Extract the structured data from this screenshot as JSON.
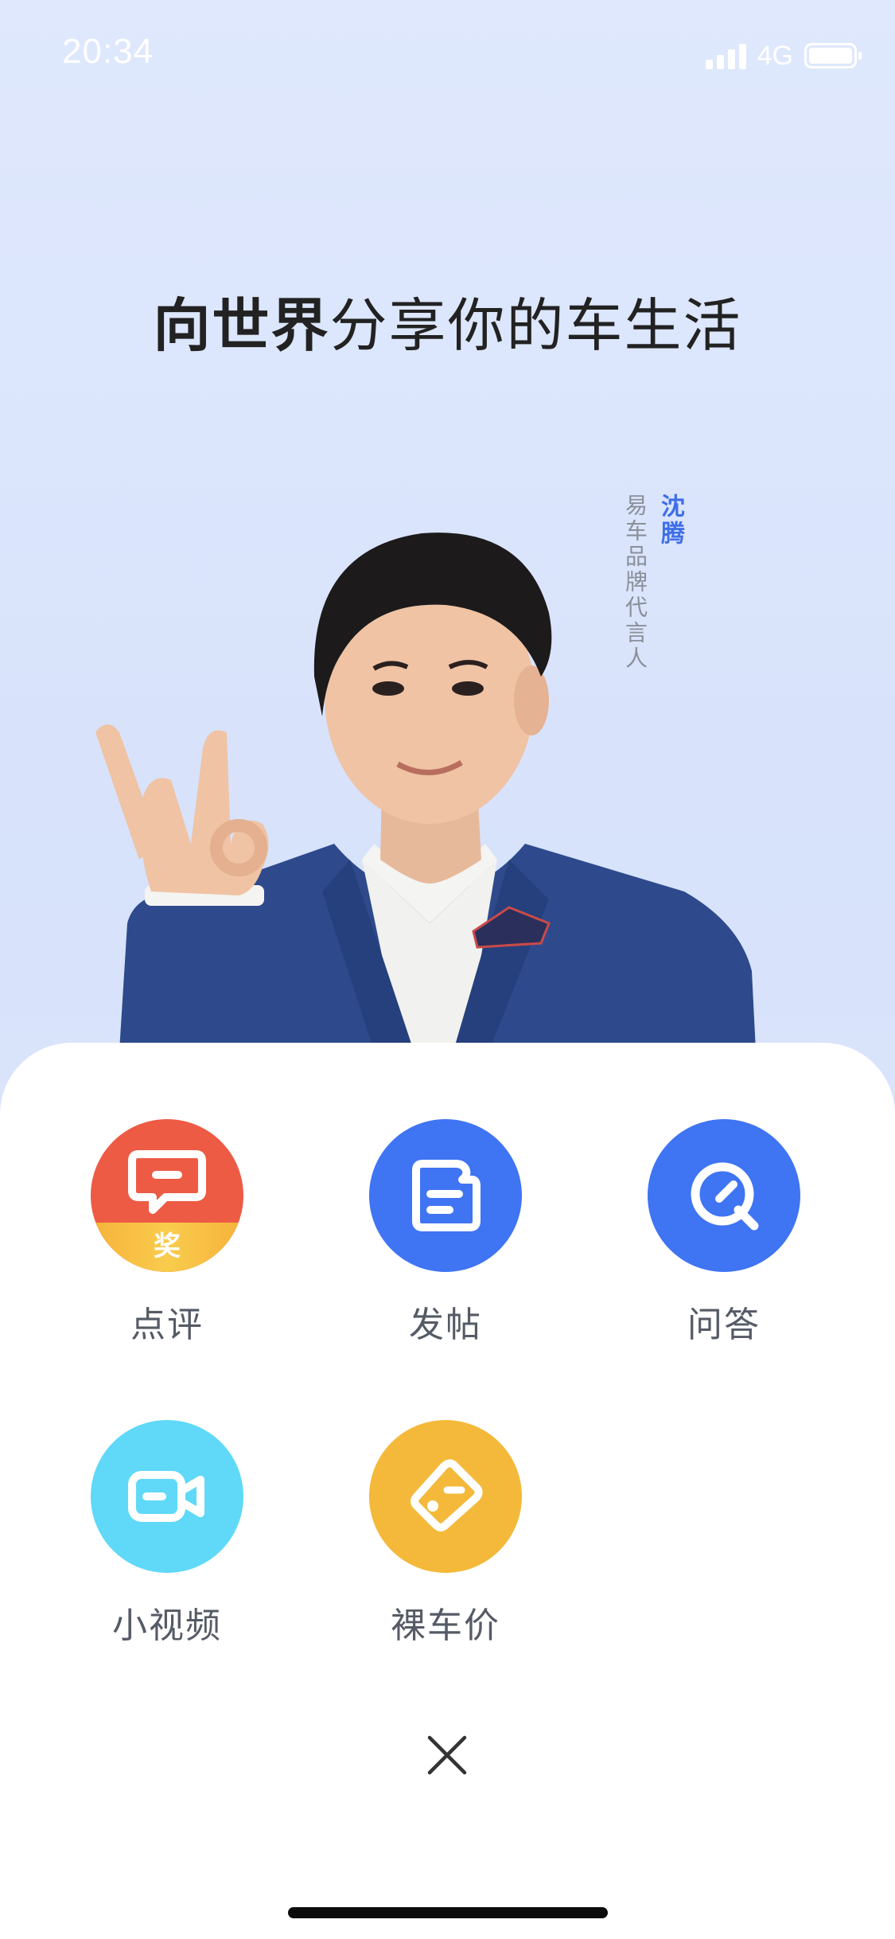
{
  "status_bar": {
    "time": "20:34",
    "network": "4G",
    "icons": [
      "signal-icon",
      "battery-icon"
    ],
    "text_color": "#ffffff"
  },
  "headline": {
    "bold": "向世界",
    "rest": "分享你的车生活"
  },
  "spokesperson": {
    "name": "沈腾",
    "role": "易车品牌代言人",
    "name_color": "#3f6fe8"
  },
  "actions": [
    {
      "label": "点评",
      "icon": "comment-icon",
      "color": "#ed5b45",
      "badge": "奖"
    },
    {
      "label": "发帖",
      "icon": "post-icon",
      "color": "#3f74f3"
    },
    {
      "label": "问答",
      "icon": "qa-icon",
      "color": "#3f74f3"
    },
    {
      "label": "小视频",
      "icon": "video-camera-icon",
      "color": "#5fd9f7"
    },
    {
      "label": "裸车价",
      "icon": "price-tag-icon",
      "color": "#f4b93b"
    }
  ],
  "close": {
    "icon": "close-icon"
  }
}
